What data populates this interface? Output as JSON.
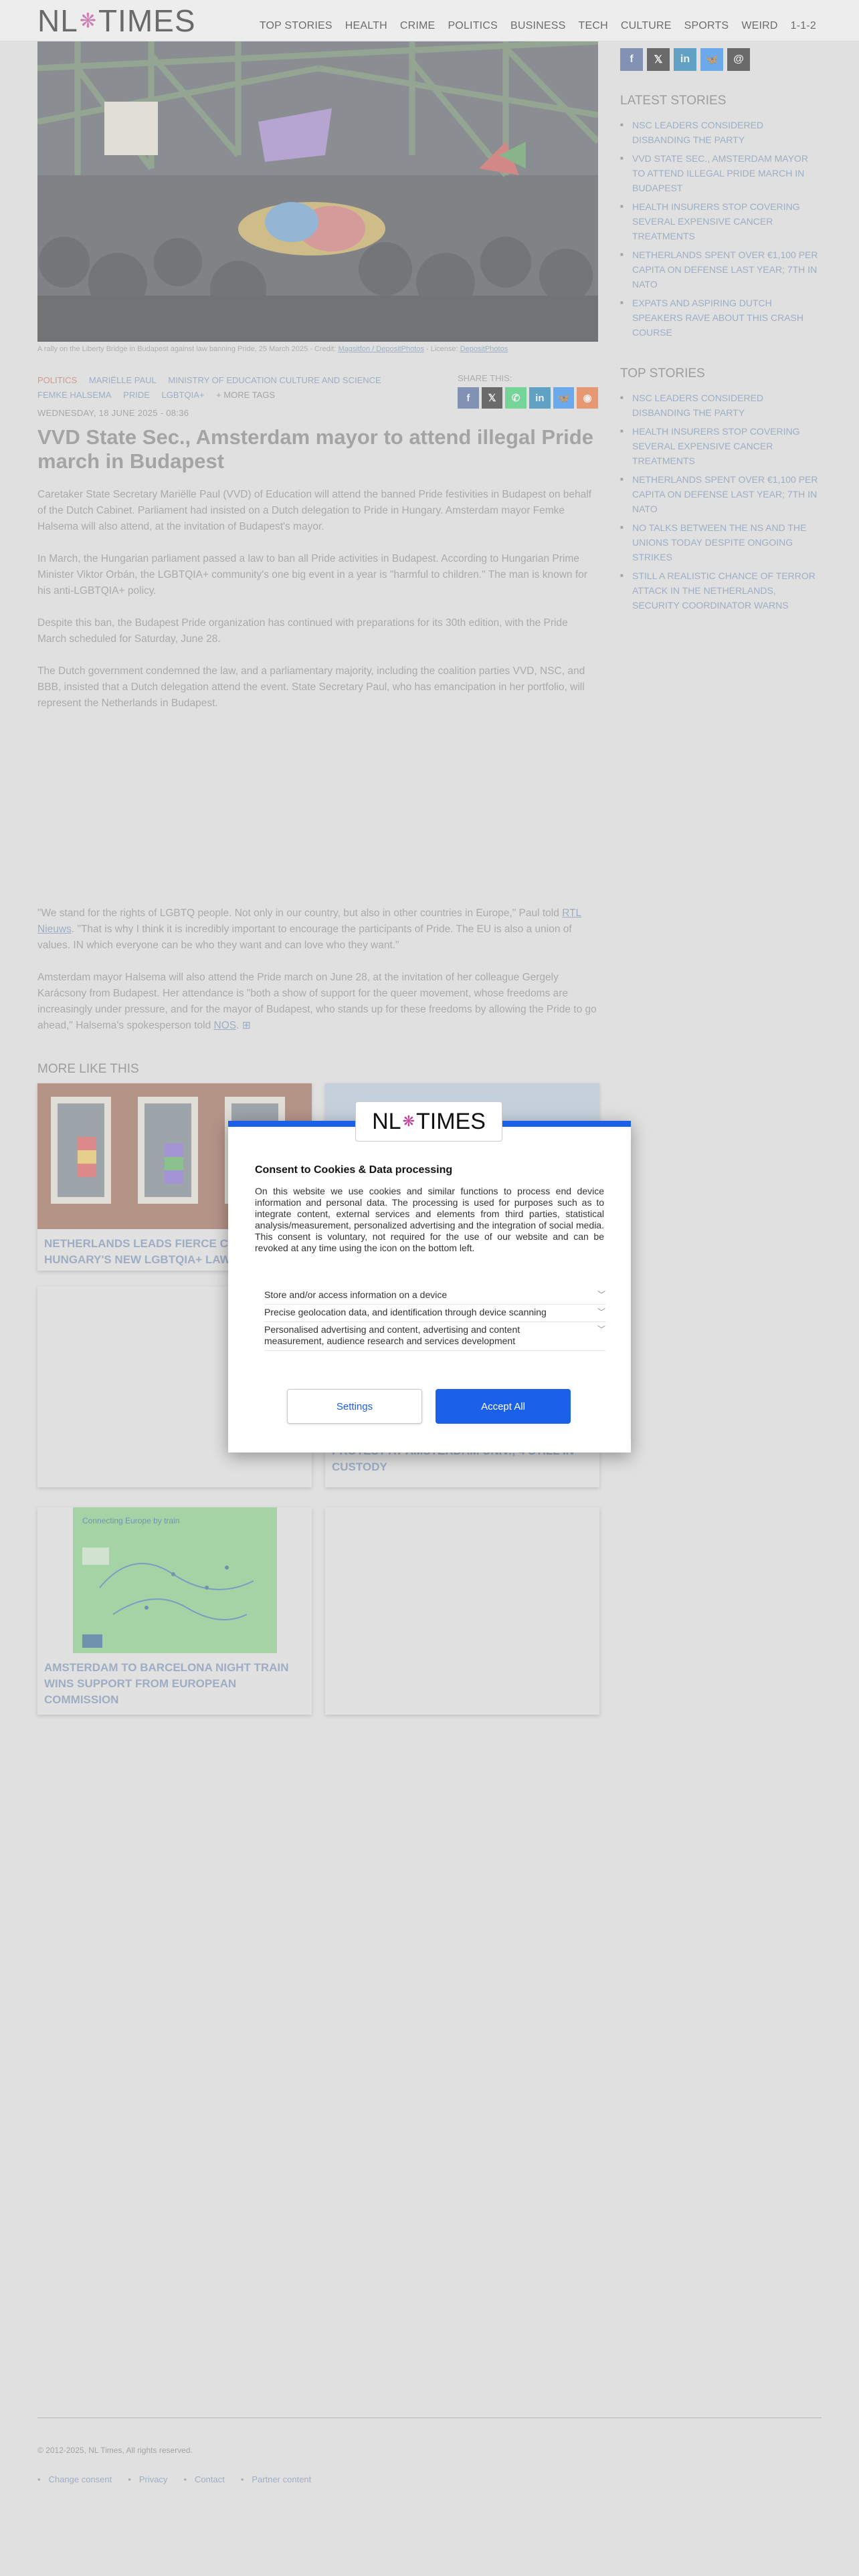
{
  "header": {
    "logo_left": "NL",
    "logo_star": "❋",
    "logo_right": "TIMES",
    "nav": [
      "TOP STORIES",
      "HEALTH",
      "CRIME",
      "POLITICS",
      "BUSINESS",
      "TECH",
      "CULTURE",
      "SPORTS",
      "WEIRD",
      "1-1-2"
    ]
  },
  "article": {
    "caption_prefix": "A rally on the Liberty Bridge in Budapest against law banning Pride, 25 March 2025 - Credit:",
    "caption_credit": "Magsitfon / DepositPhotos",
    "caption_license_label": "- License:",
    "caption_license": "DepositPhotos",
    "tags": [
      "POLITICS",
      "MARIËLLE PAUL",
      "MINISTRY OF EDUCATION CULTURE AND SCIENCE",
      "FEMKE HALSEMA",
      "PRIDE",
      "LGBTQIA+"
    ],
    "more_tags": "+ MORE TAGS",
    "share_label": "SHARE THIS:",
    "date": "WEDNESDAY, 18 JUNE 2025 - 08:36",
    "title": "VVD State Sec., Amsterdam mayor to attend illegal Pride march in Budapest",
    "p1": "Caretaker State Secretary Mariëlle Paul (VVD) of Education will attend the banned Pride festivities in Budapest on behalf of the Dutch Cabinet. Parliament had insisted on a Dutch delegation to Pride in Hungary. Amsterdam mayor Femke Halsema will also attend, at the invitation of Budapest's mayor.",
    "p2": "In March, the Hungarian parliament passed a law to ban all Pride activities in Budapest. According to Hungarian Prime Minister Viktor Orbán, the LGBTQIA+ community's one big event in a year is \"harmful to children.\" The man is known for his anti-LGBTQIA+ policy.",
    "p3": "Despite this ban, the Budapest Pride organization has continued with preparations for its 30th edition, with the Pride March scheduled for Saturday, June 28.",
    "p4": "The Dutch government condemned the law, and a parliamentary majority, including the coalition parties VVD, NSC, and BBB, insisted that a Dutch delegation attend the event. State Secretary Paul, who has emancipation in her portfolio, will represent the Netherlands in Budapest.",
    "p5_a": "\"We stand for the rights of LGBTQ people. Not only in our country, but also in other countries in Europe,\" Paul told ",
    "p5_link": "RTL Nieuws",
    "p5_b": ". \"That is why I think it is incredibly important to encourage the participants of Pride. The EU is also a union of values. IN which everyone can be who they want and can love who they want.\"",
    "p6_a": "Amsterdam mayor Halsema will also attend the Pride march on June 28, at the invitation of her colleague Gergely Karácsony from Budapest. Her attendance is \"both a show of support for the queer movement, whose freedoms are increasingly under pressure, and for the mayor of Budapest, who stands up for these freedoms by allowing the Pride to go ahead,\" Halsema's spokesperson told ",
    "p6_link": "NOS",
    "p6_end": "."
  },
  "sidebar": {
    "latest_title": "LATEST STORIES",
    "latest": [
      "NSC LEADERS CONSIDERED DISBANDING THE PARTY",
      "VVD STATE SEC., AMSTERDAM MAYOR TO ATTEND ILLEGAL PRIDE MARCH IN BUDAPEST",
      "HEALTH INSURERS STOP COVERING SEVERAL EXPENSIVE CANCER TREATMENTS",
      "NETHERLANDS SPENT OVER €1,100 PER CAPITA ON DEFENSE LAST YEAR; 7TH IN NATO",
      "EXPATS AND ASPIRING DUTCH SPEAKERS RAVE ABOUT THIS CRASH COURSE"
    ],
    "top_title": "TOP STORIES",
    "top": [
      "NSC LEADERS CONSIDERED DISBANDING THE PARTY",
      "HEALTH INSURERS STOP COVERING SEVERAL EXPENSIVE CANCER TREATMENTS",
      "NETHERLANDS SPENT OVER €1,100 PER CAPITA ON DEFENSE LAST YEAR; 7TH IN NATO",
      "NO TALKS BETWEEN THE NS AND THE UNIONS TODAY DESPITE ONGOING STRIKES",
      "STILL A REALISTIC CHANCE OF TERROR ATTACK IN THE NETHERLANDS, SECURITY COORDINATOR WARNS"
    ]
  },
  "more": {
    "title": "MORE LIKE THIS",
    "card1": "NETHERLANDS LEADS FIERCE CRITICISM OF HUNGARY'S NEW LGBTQIA+ LAWS",
    "card4": "PROTEST AT AMSTERDAM UNIV.; 4 STILL IN CUSTODY",
    "card5": "AMSTERDAM TO BARCELONA NIGHT TRAIN WINS SUPPORT FROM EUROPEAN COMMISSION",
    "card5_map_title": "Connecting Europe by train"
  },
  "footer": {
    "copyright": "© 2012-2025, NL Times, All rights reserved.",
    "links": [
      "Change consent",
      "Privacy",
      "Contact",
      "Partner content"
    ]
  },
  "consent": {
    "title": "Consent to Cookies & Data processing",
    "text": "On this website we use cookies and similar functions to process end device information and personal data. The processing is used for purposes such as to integrate content, external services and elements from third parties, statistical analysis/measurement, personalized advertising and the integration of social media. This consent is voluntary, not required for the use of our website and can be revoked at any time using the icon on the bottom left.",
    "items": [
      "Store and/or access information on a device",
      "Precise geolocation data, and identification through device scanning",
      "Personalised advertising and content, advertising and content measurement, audience research and services development"
    ],
    "settings_label": "Settings",
    "accept_label": "Accept All"
  },
  "colors": {
    "accent_blue": "#1a60e9",
    "link_blue": "#6f8bb3",
    "category_red": "#d0664f",
    "logo_star": "#c33a9a"
  }
}
